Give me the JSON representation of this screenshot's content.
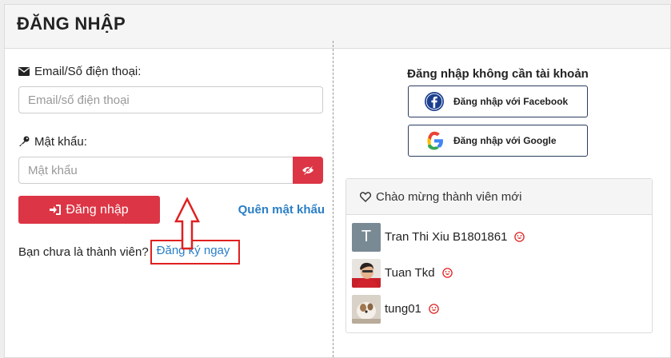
{
  "header": {
    "title": "ĐĂNG NHẬP"
  },
  "form": {
    "email_label": "Email/Số điện thoại:",
    "email_placeholder": "Email/số điện thoại",
    "password_label": "Mật khẩu:",
    "password_placeholder": "Mật khẩu",
    "login_button": "Đăng nhập",
    "forgot_link": "Quên mật khẩu",
    "signup_prompt": "Bạn chưa là thành viên?",
    "signup_link": "Đăng ký ngay"
  },
  "social": {
    "title": "Đăng nhập không cần tài khoản",
    "facebook_button": "Đăng nhập với Facebook",
    "google_button": "Đăng nhập với Google"
  },
  "welcome": {
    "title": "Chào mừng thành viên mới",
    "members": [
      {
        "name": "Tran Thi Xiu B1801861",
        "avatar_letter": "T"
      },
      {
        "name": "Tuan Tkd"
      },
      {
        "name": "tung01"
      }
    ]
  },
  "colors": {
    "accent": "#dc3545",
    "link": "#2a7ec6",
    "highlight": "#e02020"
  }
}
